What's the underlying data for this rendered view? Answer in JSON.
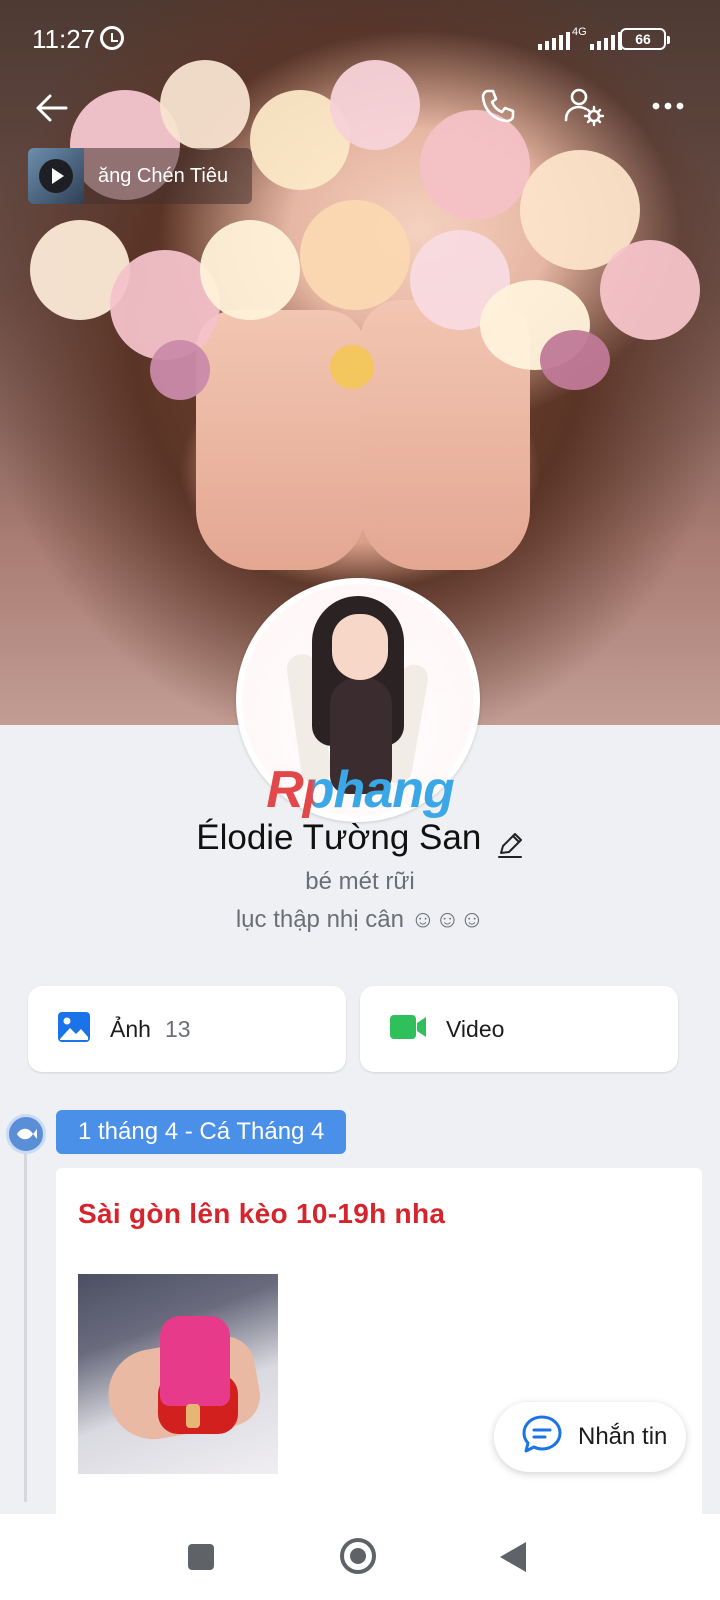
{
  "status_bar": {
    "time": "11:27",
    "network": "4G",
    "battery": "66"
  },
  "music": {
    "title": "ăng Chén Tiêu"
  },
  "profile": {
    "name": "Élodie Tường San",
    "bio_line1": "bé mét rữi",
    "bio_line2": "lục thập nhị cân ☺☺☺",
    "watermark": "Rphang"
  },
  "media": {
    "photos_label": "Ảnh",
    "photos_count": "13",
    "video_label": "Video"
  },
  "timeline": {
    "date_label": "1 tháng 4 - Cá Tháng 4",
    "post_text": "Sài gòn lên kèo 10-19h nha"
  },
  "message_button": {
    "label": "Nhắn tin"
  },
  "colors": {
    "accent_blue": "#4a8fe8",
    "post_red": "#d6242c",
    "video_green": "#2fbf5b",
    "photo_blue": "#1a73e8"
  }
}
